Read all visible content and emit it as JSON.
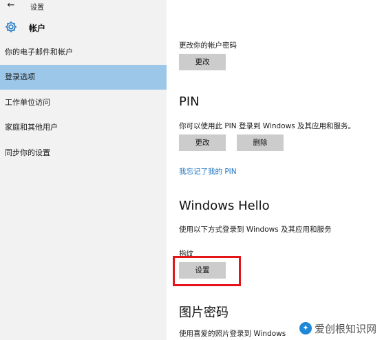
{
  "window": {
    "back_glyph": "←",
    "title": "设置"
  },
  "header": {
    "title": "帐户",
    "icon": "gear-icon"
  },
  "sidebar": {
    "items": [
      {
        "label": "你的电子邮件和帐户",
        "active": false
      },
      {
        "label": "登录选项",
        "active": true
      },
      {
        "label": "工作单位访问",
        "active": false
      },
      {
        "label": "家庭和其他用户",
        "active": false
      },
      {
        "label": "同步你的设置",
        "active": false
      }
    ],
    "active_color": "#9cc7e8"
  },
  "password": {
    "description": "更改你的帐户密码",
    "change_label": "更改"
  },
  "pin": {
    "title": "PIN",
    "description": "你可以使用此 PIN 登录到 Windows 及其应用和服务。",
    "change_label": "更改",
    "remove_label": "删除",
    "forgot_link": "我忘记了我的 PIN"
  },
  "hello": {
    "title": "Windows Hello",
    "description": "使用以下方式登录到 Windows 及其应用和服务",
    "fingerprint_label": "指纹",
    "setup_label": "设置"
  },
  "picture_password": {
    "title": "图片密码",
    "description": "使用喜爱的照片登录到 Windows"
  },
  "watermark": {
    "text": "爱创根知识网"
  },
  "colors": {
    "link": "#1b74c2",
    "button": "#cccccc",
    "highlight": "#e3151b"
  }
}
